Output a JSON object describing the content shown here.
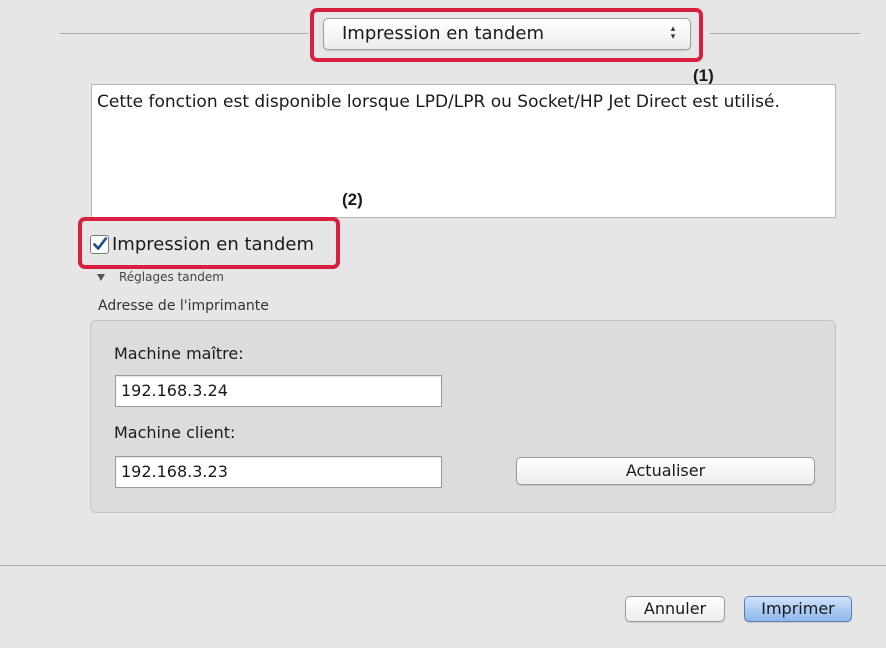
{
  "dialog": {
    "section_popup": {
      "value": "Impression en tandem",
      "arrows": "▴▾"
    },
    "callouts": {
      "one": "(1)",
      "two": "(2)"
    },
    "description": "Cette fonction est disponible lorsque LPD/LPR ou Socket/HP Jet Direct est utilisé.",
    "tandem_checkbox": {
      "label": "Impression en tandem",
      "checked": true
    },
    "tandem_settings": {
      "label": "Réglages tandem",
      "expanded": true
    },
    "printer_address": {
      "label": "Adresse de l'imprimante",
      "master": {
        "label": "Machine maître:",
        "value": "192.168.3.24"
      },
      "client": {
        "label": "Machine client:",
        "value": "192.168.3.23"
      },
      "refresh_label": "Actualiser"
    },
    "footer": {
      "cancel_label": "Annuler",
      "print_label": "Imprimer"
    }
  },
  "colors": {
    "callout": "#d8203e",
    "primary_button": "#8fb7ec",
    "background": "#e6e6e6"
  },
  "icons": {
    "checkmark": "checkmark-icon",
    "disclosure": "disclosure-triangle-icon",
    "popup_arrows": "updown-arrows-icon"
  }
}
